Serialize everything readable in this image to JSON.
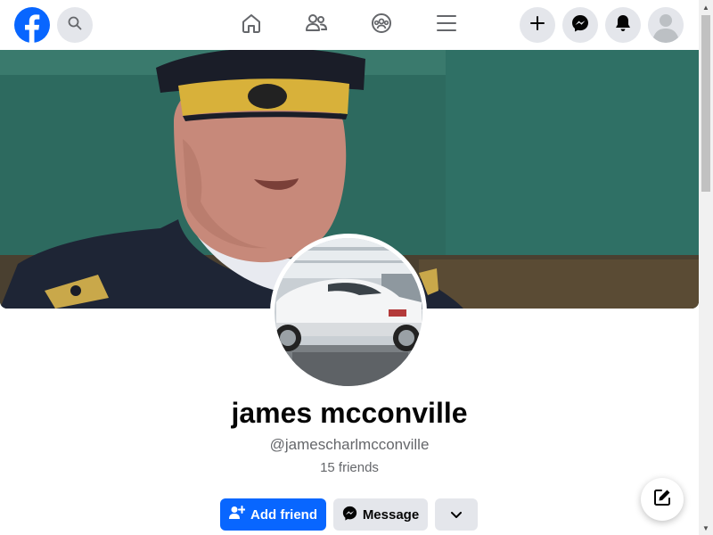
{
  "header": {
    "logo_icon": "facebook-logo",
    "search_icon": "search-icon",
    "nav": [
      "home-icon",
      "friends-icon",
      "groups-icon",
      "menu-icon"
    ],
    "actions": [
      "create-plus-icon",
      "messenger-icon",
      "notifications-bell-icon",
      "account-avatar"
    ]
  },
  "profile": {
    "name": "james mcconville",
    "username": "@jamescharlmcconville",
    "friends": "15 friends"
  },
  "buttons": {
    "add_friend": "Add friend",
    "message": "Message"
  },
  "colors": {
    "accent": "#0866ff",
    "button_gray": "#e4e6eb",
    "text_secondary": "#65676b",
    "cover_teal": "#2f6b62"
  }
}
